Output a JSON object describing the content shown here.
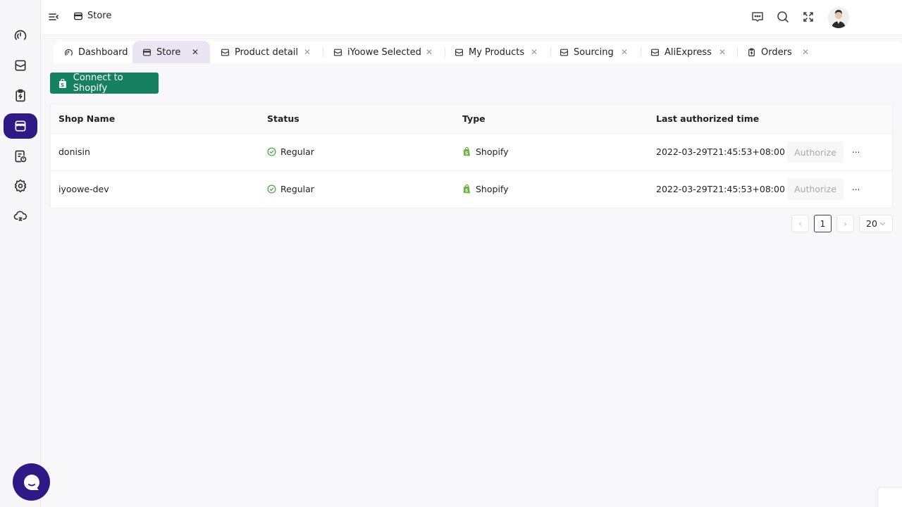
{
  "sidebar": {
    "items": [
      {
        "name": "dashboard",
        "icon": "gauge-icon"
      },
      {
        "name": "products",
        "icon": "box-icon"
      },
      {
        "name": "orders",
        "icon": "clipboard-bolt-icon"
      },
      {
        "name": "store",
        "icon": "store-icon",
        "active": true
      },
      {
        "name": "reports",
        "icon": "document-clock-icon"
      },
      {
        "name": "settings",
        "icon": "gear-icon"
      },
      {
        "name": "sync",
        "icon": "cloud-sync-icon"
      }
    ]
  },
  "header": {
    "breadcrumb": "Store"
  },
  "tabs": [
    {
      "label": "Dashboard",
      "closable": false
    },
    {
      "label": "Store",
      "closable": true,
      "active": true
    },
    {
      "label": "Product detail",
      "closable": true
    },
    {
      "label": "iYoowe Selected",
      "closable": true
    },
    {
      "label": "My Products",
      "closable": true
    },
    {
      "label": "Sourcing",
      "closable": true
    },
    {
      "label": "AliExpress",
      "closable": true
    },
    {
      "label": "Orders",
      "closable": true
    }
  ],
  "toolbar": {
    "connect_label": "Connect to Shopify"
  },
  "table": {
    "columns": [
      "Shop Name",
      "Status",
      "Type",
      "Last authorized time"
    ],
    "rows": [
      {
        "shop": "donisin",
        "status": "Regular",
        "type": "Shopify",
        "time": "2022-03-29T21:45:53+08:00",
        "action": "Authorize",
        "more": "..."
      },
      {
        "shop": "iyoowe-dev",
        "status": "Regular",
        "type": "Shopify",
        "time": "2022-03-29T21:45:53+08:00",
        "action": "Authorize",
        "more": "..."
      }
    ]
  },
  "pagination": {
    "prev": "‹",
    "current_page": "1",
    "next": "›",
    "page_size": "20"
  },
  "colors": {
    "accent": "#2e1a87",
    "shopify_green": "#17805e",
    "status_ok": "#52a84a"
  }
}
